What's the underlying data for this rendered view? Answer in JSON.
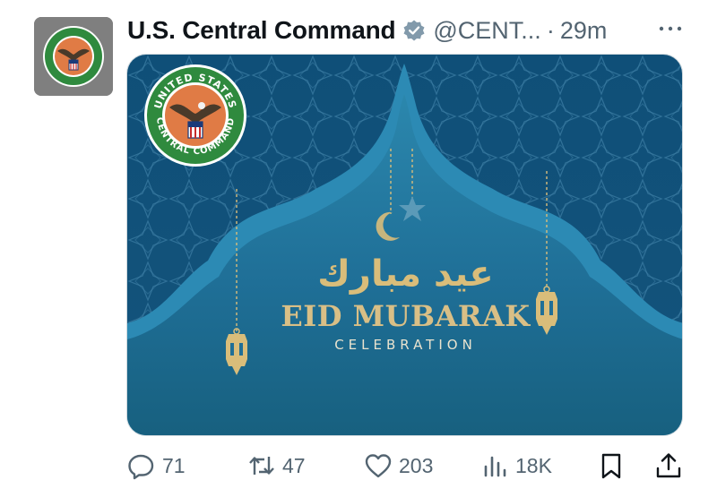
{
  "tweet": {
    "display_name": "U.S. Central Command",
    "handle": "@CENT...",
    "separator": "·",
    "time": "29m"
  },
  "media": {
    "arabic_text": "عيد مبارك",
    "title": "EID MUBARAK",
    "subtitle": "CELEBRATION",
    "seal_top_text": "UNITED STATES",
    "seal_bottom_text": "CENTRAL COMMAND"
  },
  "actions": {
    "replies": "71",
    "reposts": "47",
    "likes": "203",
    "views": "18K"
  },
  "icons": {
    "verified": "verified-badge-icon",
    "more": "more-icon",
    "reply": "reply-icon",
    "repost": "repost-icon",
    "like": "heart-icon",
    "views": "views-icon",
    "bookmark": "bookmark-icon",
    "share": "share-icon"
  },
  "colors": {
    "text_primary": "#0f1419",
    "text_secondary": "#536471",
    "verified_badge": "#829aab",
    "banner_blue": "#1f6f97",
    "gold": "#d9bd7a"
  }
}
